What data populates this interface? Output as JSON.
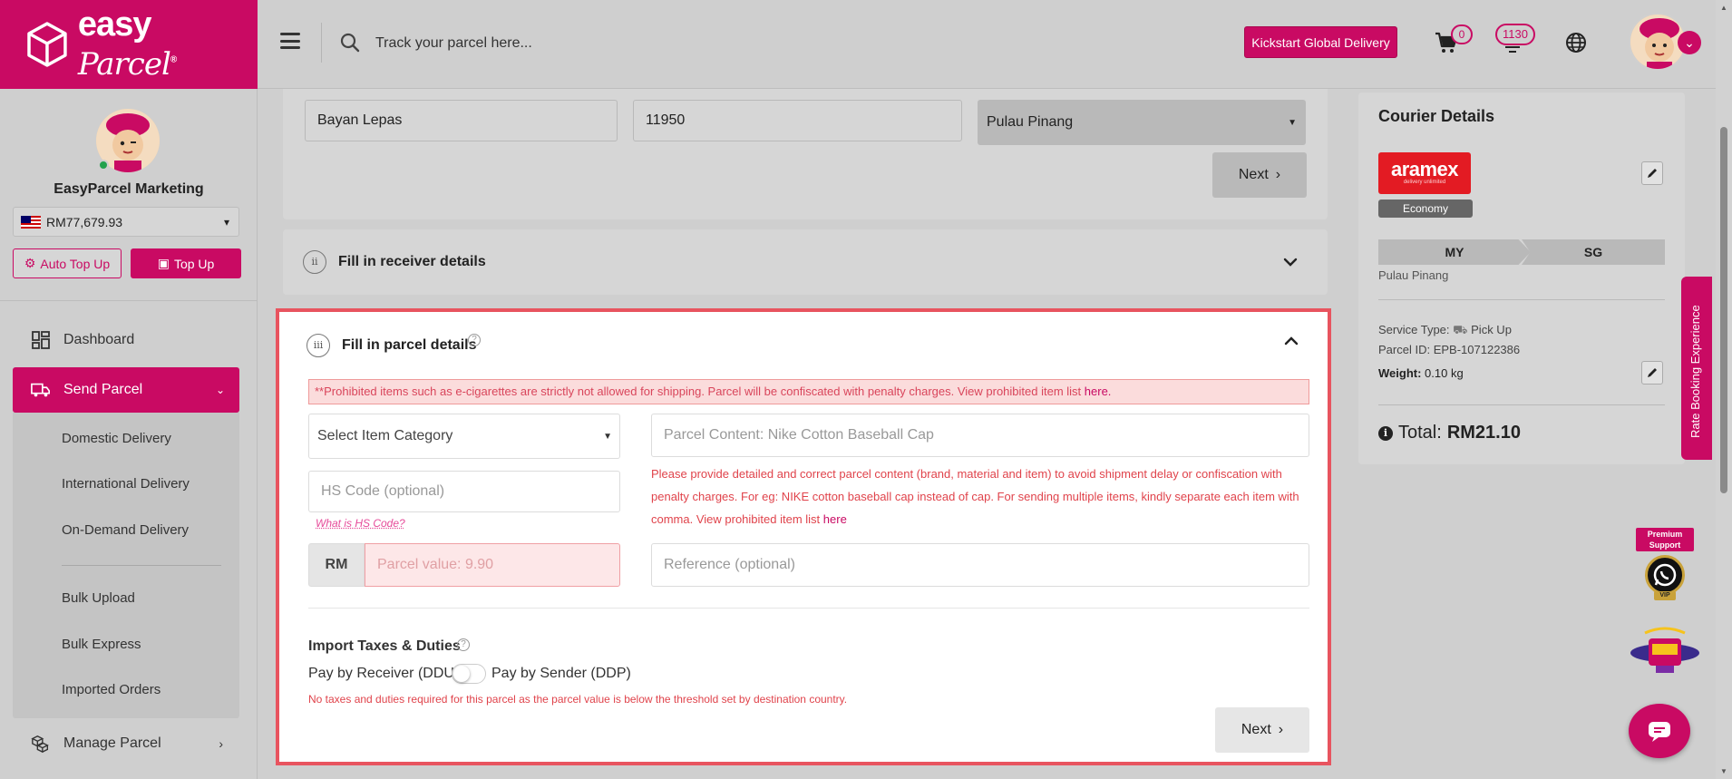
{
  "app": {
    "brand": "easy",
    "brand_script": "Parcel",
    "trademark": "®"
  },
  "topbar": {
    "search_placeholder": "Track your parcel here...",
    "kickstart_label": "Kickstart Global Delivery",
    "cart_count": "0",
    "notification_count": "1130"
  },
  "sidebar": {
    "user_name": "EasyParcel Marketing",
    "balance": "RM77,679.93",
    "auto_topup_label": "Auto Top Up",
    "topup_label": "Top Up",
    "nav": {
      "dashboard": "Dashboard",
      "send_parcel": "Send Parcel",
      "manage_parcel": "Manage Parcel"
    },
    "submenu": {
      "domestic": "Domestic Delivery",
      "international": "International Delivery",
      "on_demand": "On-Demand Delivery",
      "bulk_upload": "Bulk Upload",
      "bulk_express": "Bulk Express",
      "imported_orders": "Imported Orders"
    }
  },
  "sender": {
    "city": "Bayan Lepas",
    "postcode": "11950",
    "state": "Pulau Pinang",
    "next_label": "Next"
  },
  "receiver": {
    "step": "ii",
    "title": "Fill in receiver details"
  },
  "parcel": {
    "step": "iii",
    "title": "Fill in parcel details",
    "warning_text": "**Prohibited items such as e-cigarettes are strictly not allowed for shipping. Parcel will be confiscated with penalty charges. View prohibited item list ",
    "warning_link": "here.",
    "category_placeholder": "Select Item Category",
    "content_placeholder": "Parcel Content: Nike Cotton Baseball Cap",
    "content_note": "Please provide detailed and correct parcel content (brand, material and item) to avoid shipment delay or confiscation with penalty charges. For eg: NIKE cotton baseball cap instead of cap. For sending multiple items, kindly separate each item with comma. View prohibited item list ",
    "content_note_link": "here",
    "hs_placeholder": "HS Code (optional)",
    "hs_link": "What is HS Code?",
    "currency": "RM",
    "value_placeholder": "Parcel value: 9.90",
    "reference_placeholder": "Reference (optional)",
    "tax_title": "Import Taxes & Duties",
    "tax_ddu": "Pay by Receiver (DDU)",
    "tax_ddp": "Pay by Sender (DDP)",
    "tax_note": "No taxes and duties required for this parcel as the parcel value is below the threshold set by destination country.",
    "next_label": "Next"
  },
  "courier": {
    "title": "Courier Details",
    "logo_text": "aramex",
    "logo_sub": "delivery unlimited",
    "service_class": "Economy",
    "origin": "MY",
    "destination": "SG",
    "origin_state": "Pulau Pinang",
    "service_type_label": "Service Type:",
    "service_type": "Pick Up",
    "parcel_id_label": "Parcel ID:",
    "parcel_id": "EPB-107122386",
    "weight_label": "Weight:",
    "weight": "0.10 kg",
    "total_label": "Total:",
    "total": "RM21.10"
  },
  "widgets": {
    "rate_tab": "Rate Booking Experience",
    "premium_support": "Premium Support",
    "vip": "VIP"
  },
  "colors": {
    "brand": "#c90a63",
    "warning": "#e0434b",
    "highlight_border": "#e8545f"
  }
}
